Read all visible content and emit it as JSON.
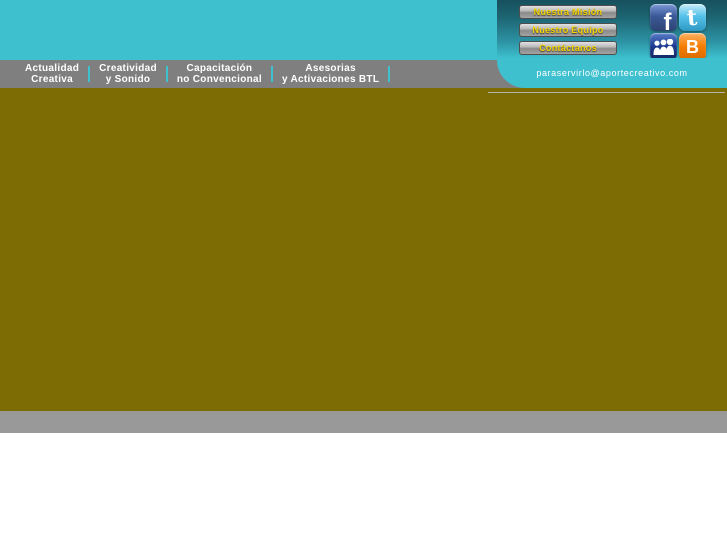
{
  "header": {
    "nav_items": [
      {
        "line1": "Actualidad",
        "line2": "Creativa"
      },
      {
        "line1": "Creatividad",
        "line2": "y Sonido"
      },
      {
        "line1": "Capacitación",
        "line2": "no Convencional"
      },
      {
        "line1": "Asesorias",
        "line2": "y Activaciones BTL"
      }
    ],
    "buttons": [
      {
        "label": "Nuestra Misión"
      },
      {
        "label": "Nuestro Equipo"
      },
      {
        "label": "Contáctanos"
      }
    ],
    "social": [
      {
        "name": "facebook",
        "glyph": "f"
      },
      {
        "name": "twitter",
        "glyph": "t"
      },
      {
        "name": "myspace",
        "glyph": ""
      },
      {
        "name": "blogger",
        "glyph": "B"
      }
    ],
    "email": "paraservirlo@aportecreativo.com"
  },
  "colors": {
    "teal_accent": "#3ec0ce",
    "panel_dark_teal": "#16505c",
    "nav_gray": "#7f7f7f",
    "content_olive": "#7d6c03",
    "footer_gray": "#999999",
    "button_text_yellow": "#f5d400",
    "facebook_blue": "#3b5998",
    "twitter_blue": "#56c2e9",
    "myspace_navy": "#1d3a8f",
    "blogger_orange": "#f57d00"
  }
}
